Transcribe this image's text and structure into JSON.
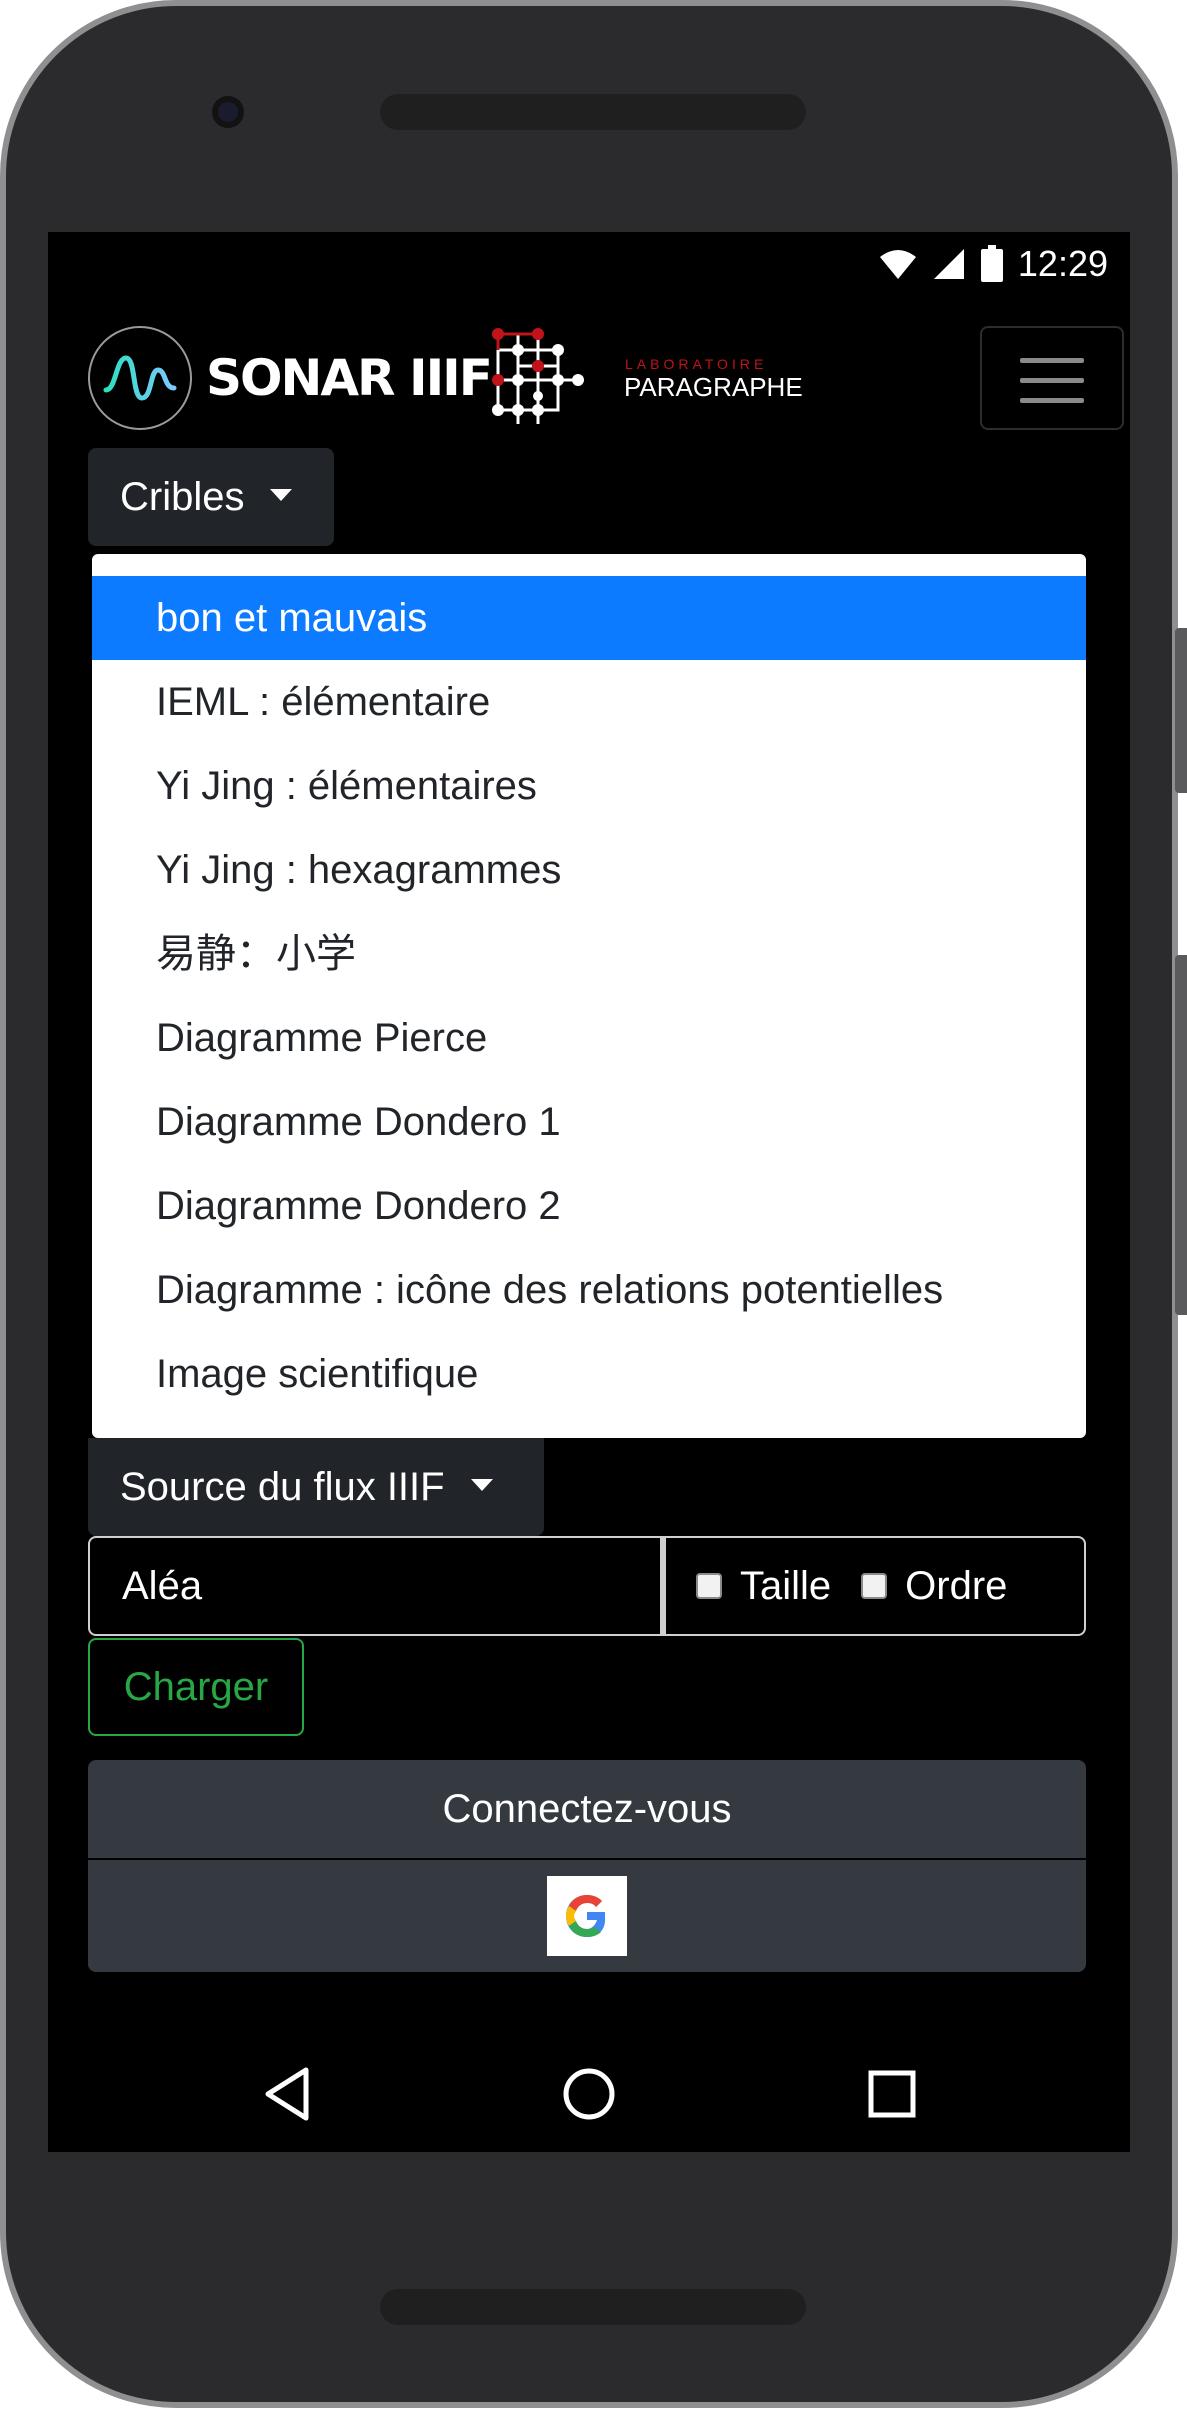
{
  "status_bar": {
    "time": "12:29",
    "icons": [
      "wifi-icon",
      "cell-signal-icon",
      "battery-icon"
    ]
  },
  "header": {
    "brand": "SONAR IIIF",
    "lab_small": "LABORATOIRE",
    "lab_big": "PARAGRAPHE",
    "menu_icon": "hamburger-menu-icon"
  },
  "cribles": {
    "label": "Cribles",
    "items": [
      "bon et mauvais",
      "IEML : élémentaire",
      "Yi Jing : élémentaires",
      "Yi Jing : hexagrammes",
      "易静：小学",
      "Diagramme Pierce",
      "Diagramme Dondero 1",
      "Diagramme Dondero 2",
      "Diagramme : icône des relations potentielles",
      "Image scientifique"
    ],
    "active_index": 0
  },
  "source": {
    "label": "Source du flux IIIF"
  },
  "filters": {
    "value": "Aléa",
    "size_label": "Taille",
    "order_label": "Ordre"
  },
  "actions": {
    "load": "Charger",
    "login": "Connectez-vous",
    "google_icon": "google-icon"
  },
  "colors": {
    "active": "#0d7bff",
    "success": "#28a745",
    "dark_button": "#212529",
    "grey_button": "#343a40",
    "accent_teal": "#2de0c0",
    "lab_red": "#c0131a"
  }
}
